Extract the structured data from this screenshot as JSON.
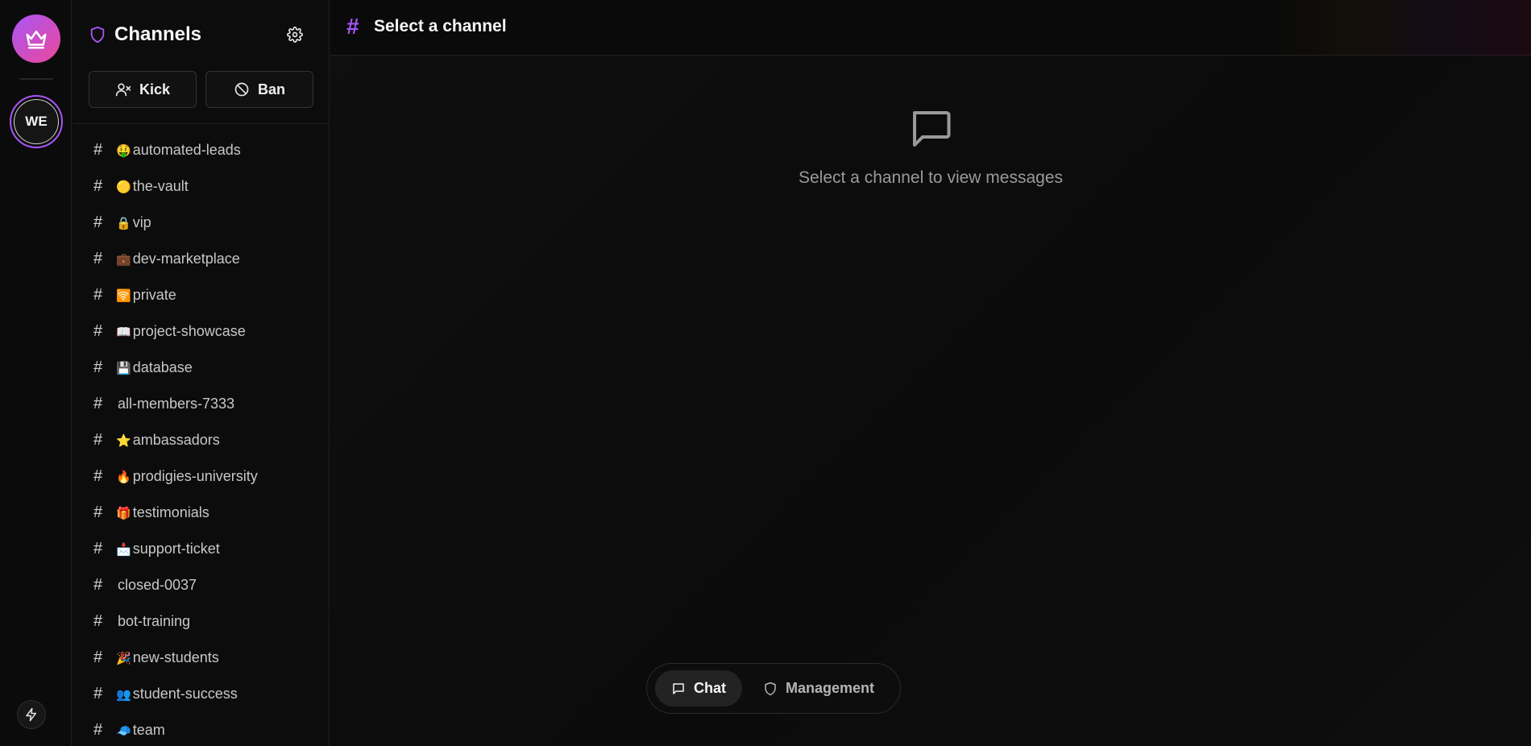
{
  "rail": {
    "server_initials": "WE"
  },
  "sidebar": {
    "title": "Channels",
    "kick_label": "Kick",
    "ban_label": "Ban",
    "channels": [
      {
        "emoji": "🤑",
        "name": "automated-leads"
      },
      {
        "emoji": "🟡",
        "name": "the-vault"
      },
      {
        "emoji": "🔒",
        "name": "vip"
      },
      {
        "emoji": "💼",
        "name": "dev-marketplace"
      },
      {
        "emoji": "🛜",
        "name": "private"
      },
      {
        "emoji": "📖",
        "name": "project-showcase"
      },
      {
        "emoji": "💾",
        "name": "database"
      },
      {
        "emoji": "",
        "name": "all-members-7333"
      },
      {
        "emoji": "⭐",
        "name": "ambassadors"
      },
      {
        "emoji": "🔥",
        "name": "prodigies-university"
      },
      {
        "emoji": "🎁",
        "name": "testimonials"
      },
      {
        "emoji": "📩",
        "name": "support-ticket"
      },
      {
        "emoji": "",
        "name": "closed-0037"
      },
      {
        "emoji": "",
        "name": "bot-training"
      },
      {
        "emoji": "🎉",
        "name": "new-students"
      },
      {
        "emoji": "👥",
        "name": "student-success"
      },
      {
        "emoji": "🧢",
        "name": "team"
      }
    ]
  },
  "main": {
    "title": "Select a channel",
    "empty_message": "Select a channel to view messages"
  },
  "tabs": {
    "chat": "Chat",
    "management": "Management"
  },
  "colors": {
    "accent": "#a855f7",
    "accent_pink": "#ec4899",
    "background": "#0a0a0a"
  }
}
